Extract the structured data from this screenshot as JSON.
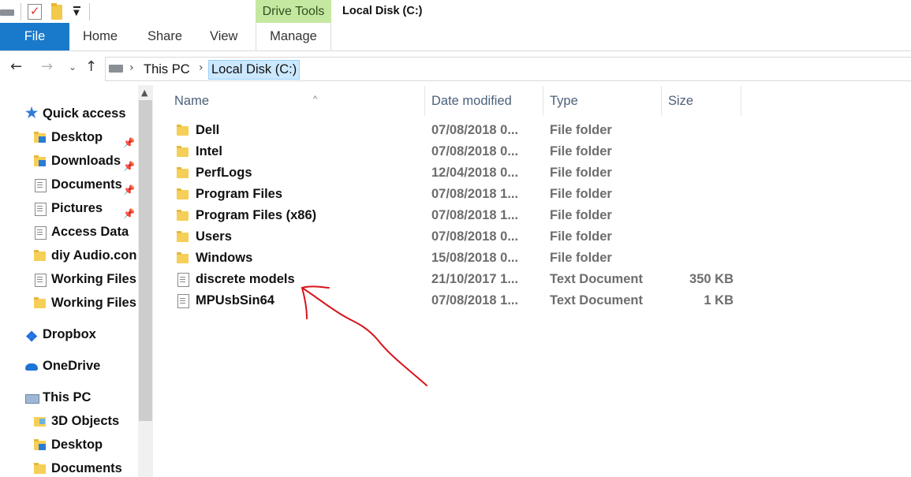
{
  "window": {
    "title": "Local Disk (C:)",
    "context_tab_group": "Drive Tools"
  },
  "ribbon": {
    "tabs": [
      {
        "label": "File"
      },
      {
        "label": "Home"
      },
      {
        "label": "Share"
      },
      {
        "label": "View"
      },
      {
        "label": "Manage"
      }
    ],
    "accent": "#1979ca",
    "context_color": "#c5e8a0"
  },
  "address": {
    "crumbs": [
      "This PC",
      "Local Disk (C:)"
    ]
  },
  "navpane": {
    "items": [
      {
        "label": "Quick access",
        "icon": "star-icon",
        "pinned": false
      },
      {
        "label": "Desktop",
        "icon": "folder-icon",
        "pinned": true
      },
      {
        "label": "Downloads",
        "icon": "folder-icon",
        "pinned": true
      },
      {
        "label": "Documents",
        "icon": "document-icon",
        "pinned": true
      },
      {
        "label": "Pictures",
        "icon": "document-icon",
        "pinned": true
      },
      {
        "label": "Access Data",
        "icon": "document-icon",
        "pinned": false
      },
      {
        "label": "diy Audio.con",
        "icon": "folder-icon",
        "pinned": false
      },
      {
        "label": "Working Files",
        "icon": "document-icon",
        "pinned": false
      },
      {
        "label": "Working Files",
        "icon": "folder-icon",
        "pinned": false
      },
      {
        "label": "Dropbox",
        "icon": "dropbox-icon",
        "pinned": false
      },
      {
        "label": "OneDrive",
        "icon": "cloud-icon",
        "pinned": false
      },
      {
        "label": "This PC",
        "icon": "computer-icon",
        "pinned": false
      },
      {
        "label": "3D Objects",
        "icon": "folder-icon",
        "pinned": false
      },
      {
        "label": "Desktop",
        "icon": "folder-icon",
        "pinned": false
      },
      {
        "label": "Documents",
        "icon": "folder-icon",
        "pinned": false
      }
    ]
  },
  "filelist": {
    "columns": {
      "name": "Name",
      "date": "Date modified",
      "type": "Type",
      "size": "Size"
    },
    "rows": [
      {
        "name": "Dell",
        "date": "07/08/2018 0...",
        "type": "File folder",
        "size": "",
        "icon": "folder-icon"
      },
      {
        "name": "Intel",
        "date": "07/08/2018 0...",
        "type": "File folder",
        "size": "",
        "icon": "folder-icon"
      },
      {
        "name": "PerfLogs",
        "date": "12/04/2018 0...",
        "type": "File folder",
        "size": "",
        "icon": "folder-icon"
      },
      {
        "name": "Program Files",
        "date": "07/08/2018 1...",
        "type": "File folder",
        "size": "",
        "icon": "folder-icon"
      },
      {
        "name": "Program Files (x86)",
        "date": "07/08/2018 1...",
        "type": "File folder",
        "size": "",
        "icon": "folder-icon"
      },
      {
        "name": "Users",
        "date": "07/08/2018 0...",
        "type": "File folder",
        "size": "",
        "icon": "folder-icon"
      },
      {
        "name": "Windows",
        "date": "15/08/2018 0...",
        "type": "File folder",
        "size": "",
        "icon": "folder-icon"
      },
      {
        "name": "discrete models",
        "date": "21/10/2017 1...",
        "type": "Text Document",
        "size": "350 KB",
        "icon": "text-document-icon"
      },
      {
        "name": "MPUsbSin64",
        "date": "07/08/2018 1...",
        "type": "Text Document",
        "size": "1 KB",
        "icon": "text-document-icon"
      }
    ]
  },
  "annotation": {
    "color": "#d9141b"
  }
}
